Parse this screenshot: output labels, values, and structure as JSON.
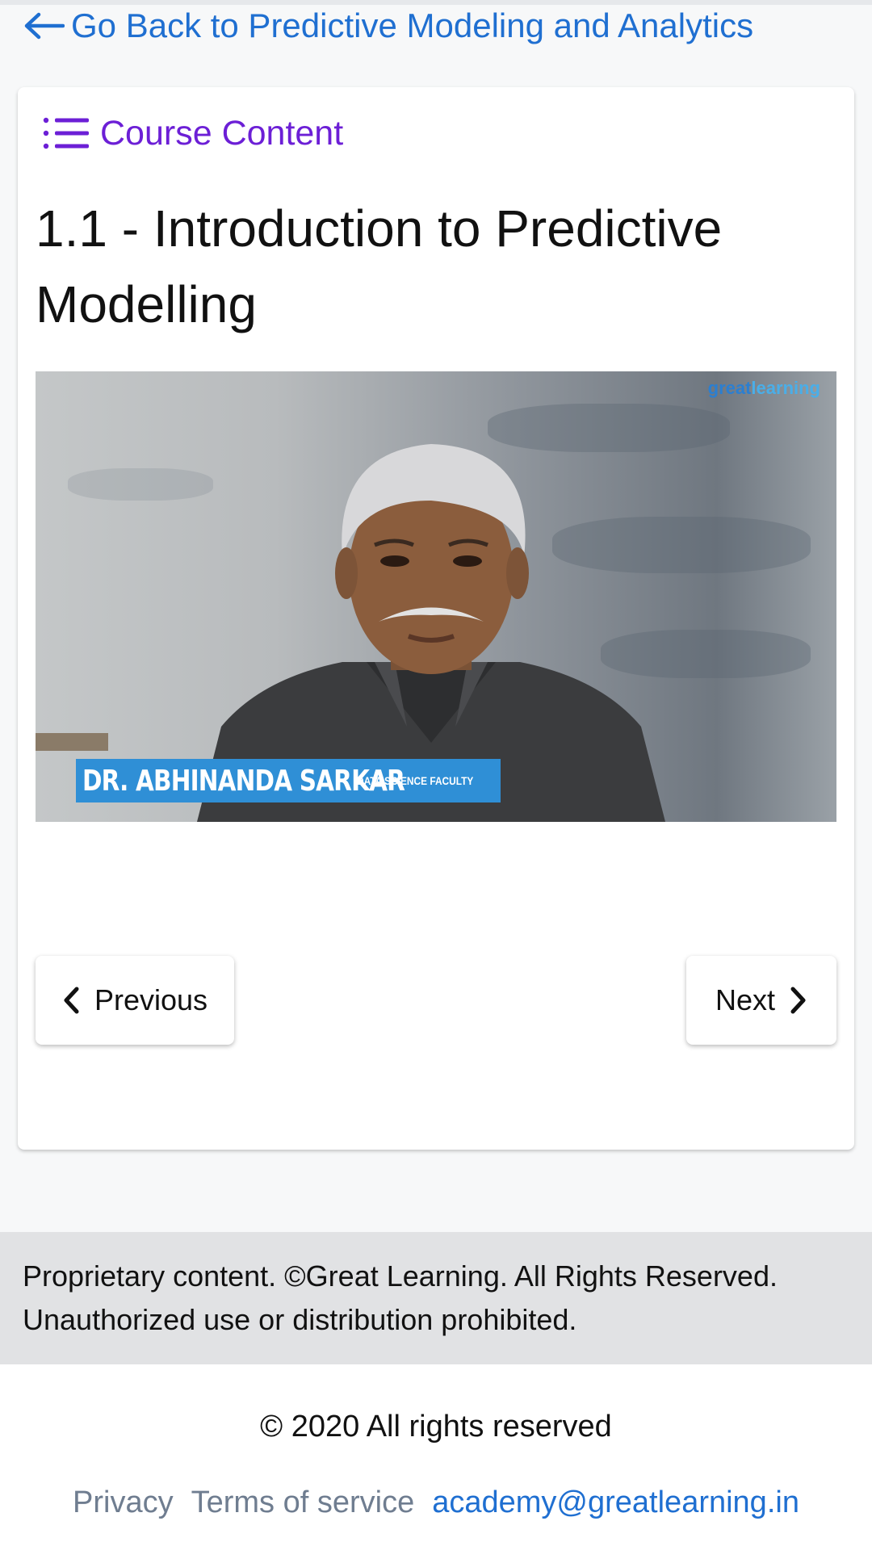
{
  "header": {
    "back_label": "Go Back to Predictive Modeling and Analytics"
  },
  "card": {
    "course_content_label": "Course Content",
    "lesson_title": "1.1 - Introduction to Predictive Modelling",
    "video": {
      "brand_part1": "great",
      "brand_part2": "learning",
      "presenter_name": "DR. ABHINANDA SARKAR",
      "presenter_role": "DATA SCIENCE FACULTY"
    },
    "nav": {
      "previous_label": "Previous",
      "next_label": "Next"
    }
  },
  "notice": {
    "text": "Proprietary content. ©Great Learning. All Rights Reserved. Unauthorized use or distribution prohibited."
  },
  "footer": {
    "copyright": "© 2020 All rights reserved",
    "links": {
      "privacy": "Privacy",
      "terms": "Terms of service",
      "email": "academy@greatlearning.in"
    }
  },
  "colors": {
    "link_blue": "#1f6fd1",
    "accent_purple": "#6c1fd6",
    "notice_bg": "#e1e2e4",
    "page_bg": "#f7f8f9"
  },
  "icons": {
    "back": "arrow-left-icon",
    "course_content": "list-icon",
    "previous": "chevron-left-icon",
    "next": "chevron-right-icon"
  }
}
